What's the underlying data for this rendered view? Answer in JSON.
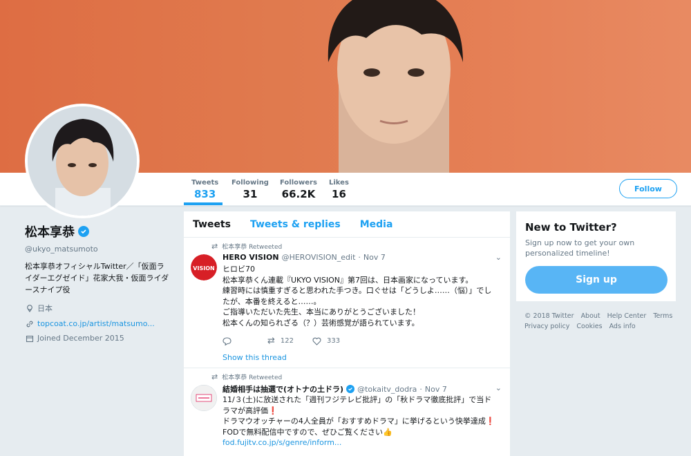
{
  "nav": {
    "items": [
      {
        "label": "Tweets",
        "value": "833"
      },
      {
        "label": "Following",
        "value": "31"
      },
      {
        "label": "Followers",
        "value": "66.2K"
      },
      {
        "label": "Likes",
        "value": "16"
      }
    ],
    "follow_label": "Follow"
  },
  "profile": {
    "name": "松本享恭",
    "handle": "@ukyo_matsumoto",
    "bio": "松本享恭オフィシャルTwitter／「仮面ライダーエグゼイド」花家大我・仮面ライダースナイプ役",
    "location": "日本",
    "website": "topcoat.co.jp/artist/matsumo...",
    "joined": "Joined December 2015"
  },
  "timeline": {
    "tabs": [
      "Tweets",
      "Tweets & replies",
      "Media"
    ],
    "tweets": [
      {
        "retweeted_by": "松本享恭 Retweeted",
        "name": "HERO VISION",
        "handle": "@HEROVISION_edit",
        "date": "Nov 7",
        "avatar_text": "VISION",
        "lines": [
          "ヒロビ70",
          "松本享恭くん連載『UKYO VISION』第7回は、日本画家になっています。",
          "練習時には慎重すぎると思われた手つき。口ぐせは「どうしよ……（悩）」でし",
          "たが、本番を終えると……。",
          "ご指導いただいた先生、本当にありがとうございました！",
          "松本くんの知られざる（？）芸術感覚が語られています。"
        ],
        "retweets": "122",
        "likes": "333",
        "thread": "Show this thread"
      },
      {
        "retweeted_by": "松本享恭 Retweeted",
        "name": "結婚相手は抽選で(オトナの土ドラ)",
        "handle": "@tokaitv_dodra",
        "date": "Nov 7",
        "lines": [
          "11/３(土)に放送された「週刊フジテレビ批評」の「秋ドラマ徹底批評」で当ド",
          "ラマが高評価❗",
          "ドラマウオッチャーの4人全員が「おすすめドラマ」に挙げるという快挙達成❗",
          "FODで無料配信中ですので、ぜひご覧ください👍"
        ],
        "link": "fod.fujitv.co.jp/s/genre/inform..."
      }
    ]
  },
  "sidebar": {
    "title": "New to Twitter?",
    "text": "Sign up now to get your own personalized timeline!",
    "signup_label": "Sign up"
  },
  "footer": {
    "copyright": "© 2018 Twitter",
    "links": [
      "About",
      "Help Center",
      "Terms",
      "Privacy policy",
      "Cookies",
      "Ads info"
    ]
  }
}
